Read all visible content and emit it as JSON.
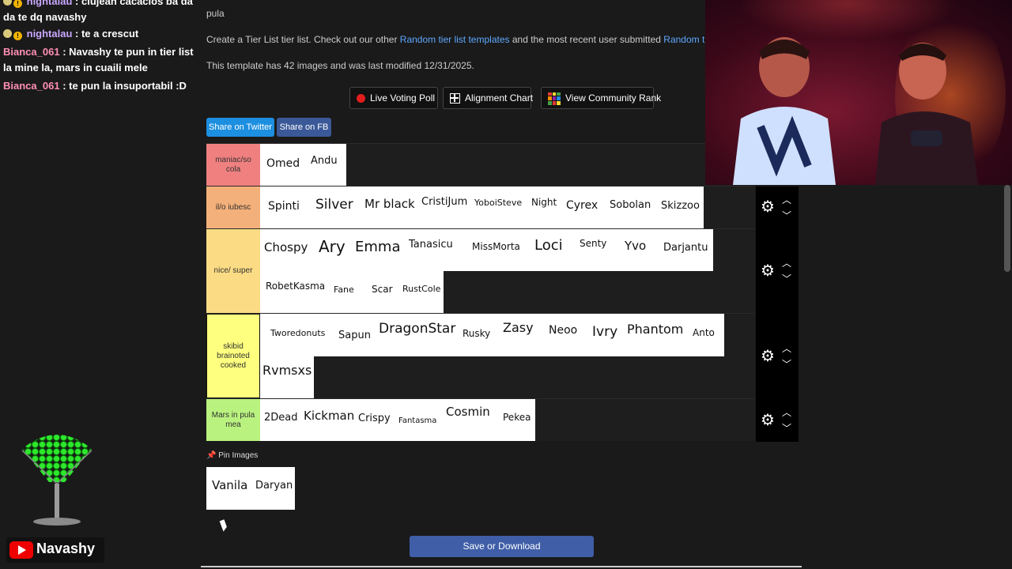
{
  "chat": {
    "messages": [
      {
        "user": "nightalau",
        "text": ": clujean cacacios ba da da te dq navashy",
        "badges": [
          "moon-badge",
          "gold-badge"
        ]
      },
      {
        "user": "nightalau",
        "text": ": te a crescut",
        "badges": [
          "moon-badge",
          "gold-badge"
        ]
      },
      {
        "user": "Bianca_061",
        "text": ": Navashy te pun in tier list la mine la, mars in cuaili mele",
        "badges": []
      },
      {
        "user": "Bianca_061",
        "text": ": te pun la insuportabil :D",
        "badges": []
      }
    ]
  },
  "brand": {
    "channel": "Navashy",
    "icon": "youtube-icon",
    "accent": "#ff0000"
  },
  "page": {
    "title_fragment": "pula",
    "intro": {
      "prefix": "Create a Tier List tier list. Check out our other ",
      "link1": "Random tier list templates",
      "middle": " and the most recent user submitted ",
      "link2": "Random tier lists"
    },
    "template_info": "This template has 42 images and was last modified 12/31/2025.",
    "buttons": {
      "live_voting": "Live Voting Poll",
      "alignment": "Alignment Chart",
      "community_rank": "View Community Rank"
    },
    "share": {
      "twitter": "Share on Twitter",
      "fb": "Share on FB"
    },
    "pin_label": "Pin Images",
    "save": "Save or Download"
  },
  "tiers": [
    {
      "label": "maniac/so cola",
      "color": "#f08080",
      "items": [
        "Omed",
        "Andu"
      ]
    },
    {
      "label": "il/o iubesc",
      "color": "#f4b07a",
      "items": [
        "Spinti",
        "Silver",
        "Mr black",
        "CristiJum",
        "YoboiSteve",
        "Night",
        "Cyrex",
        "Sobolan",
        "Skizzoo"
      ]
    },
    {
      "label": "nice/ super",
      "color": "#fbdc84",
      "items": [
        "Chospy",
        "Ary",
        "Emma",
        "Tanasicu",
        "MissMorta",
        "Loci",
        "Senty",
        "Yvo",
        "Darjantu",
        "RobetKasma",
        "Fane",
        "Scar",
        "RustCole"
      ]
    },
    {
      "label": "skibid brainoted cooked",
      "color": "#ffff7f",
      "items": [
        "Tworedonuts",
        "Sapun",
        "DragonStar",
        "Rusky",
        "Zasy",
        "Neoo",
        "Ivry",
        "Phantom",
        "Anto",
        "Rvmsxs"
      ]
    },
    {
      "label": "Mars in pula mea",
      "color": "#b9f27f",
      "items": [
        "2Dead",
        "Kickman",
        "Crispy",
        "Fantasma",
        "Cosmin",
        "Pekea"
      ]
    }
  ],
  "pinned": [
    "Vanila",
    "Daryan"
  ],
  "icons": {
    "settings": "gear-icon",
    "up": "chevron-up-icon",
    "down": "chevron-down-icon",
    "pin": "pin-icon"
  },
  "colors": {
    "share_twitter": "#1da1f2",
    "share_fb": "#3b5998",
    "save": "#3f5ea7",
    "link": "#5fa8ff"
  }
}
